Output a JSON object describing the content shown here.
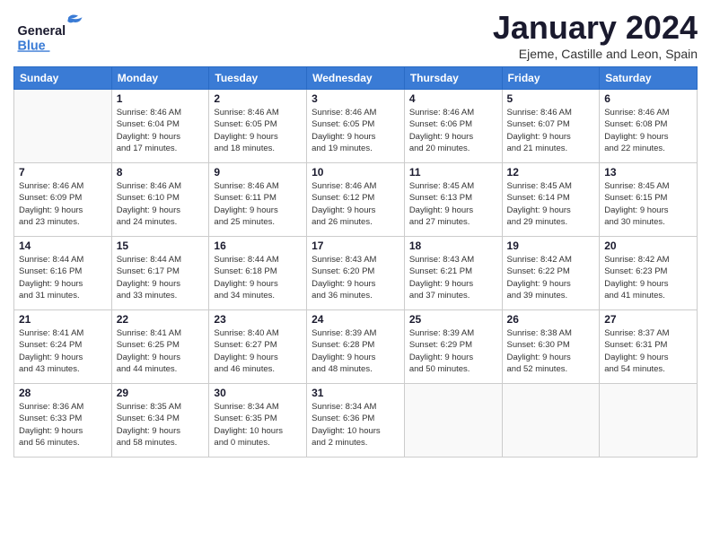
{
  "header": {
    "logo_general": "General",
    "logo_blue": "Blue",
    "month_title": "January 2024",
    "subtitle": "Ejeme, Castille and Leon, Spain"
  },
  "weekdays": [
    "Sunday",
    "Monday",
    "Tuesday",
    "Wednesday",
    "Thursday",
    "Friday",
    "Saturday"
  ],
  "weeks": [
    [
      {
        "day": "",
        "info": ""
      },
      {
        "day": "1",
        "info": "Sunrise: 8:46 AM\nSunset: 6:04 PM\nDaylight: 9 hours\nand 17 minutes."
      },
      {
        "day": "2",
        "info": "Sunrise: 8:46 AM\nSunset: 6:05 PM\nDaylight: 9 hours\nand 18 minutes."
      },
      {
        "day": "3",
        "info": "Sunrise: 8:46 AM\nSunset: 6:05 PM\nDaylight: 9 hours\nand 19 minutes."
      },
      {
        "day": "4",
        "info": "Sunrise: 8:46 AM\nSunset: 6:06 PM\nDaylight: 9 hours\nand 20 minutes."
      },
      {
        "day": "5",
        "info": "Sunrise: 8:46 AM\nSunset: 6:07 PM\nDaylight: 9 hours\nand 21 minutes."
      },
      {
        "day": "6",
        "info": "Sunrise: 8:46 AM\nSunset: 6:08 PM\nDaylight: 9 hours\nand 22 minutes."
      }
    ],
    [
      {
        "day": "7",
        "info": "Sunrise: 8:46 AM\nSunset: 6:09 PM\nDaylight: 9 hours\nand 23 minutes."
      },
      {
        "day": "8",
        "info": "Sunrise: 8:46 AM\nSunset: 6:10 PM\nDaylight: 9 hours\nand 24 minutes."
      },
      {
        "day": "9",
        "info": "Sunrise: 8:46 AM\nSunset: 6:11 PM\nDaylight: 9 hours\nand 25 minutes."
      },
      {
        "day": "10",
        "info": "Sunrise: 8:46 AM\nSunset: 6:12 PM\nDaylight: 9 hours\nand 26 minutes."
      },
      {
        "day": "11",
        "info": "Sunrise: 8:45 AM\nSunset: 6:13 PM\nDaylight: 9 hours\nand 27 minutes."
      },
      {
        "day": "12",
        "info": "Sunrise: 8:45 AM\nSunset: 6:14 PM\nDaylight: 9 hours\nand 29 minutes."
      },
      {
        "day": "13",
        "info": "Sunrise: 8:45 AM\nSunset: 6:15 PM\nDaylight: 9 hours\nand 30 minutes."
      }
    ],
    [
      {
        "day": "14",
        "info": "Sunrise: 8:44 AM\nSunset: 6:16 PM\nDaylight: 9 hours\nand 31 minutes."
      },
      {
        "day": "15",
        "info": "Sunrise: 8:44 AM\nSunset: 6:17 PM\nDaylight: 9 hours\nand 33 minutes."
      },
      {
        "day": "16",
        "info": "Sunrise: 8:44 AM\nSunset: 6:18 PM\nDaylight: 9 hours\nand 34 minutes."
      },
      {
        "day": "17",
        "info": "Sunrise: 8:43 AM\nSunset: 6:20 PM\nDaylight: 9 hours\nand 36 minutes."
      },
      {
        "day": "18",
        "info": "Sunrise: 8:43 AM\nSunset: 6:21 PM\nDaylight: 9 hours\nand 37 minutes."
      },
      {
        "day": "19",
        "info": "Sunrise: 8:42 AM\nSunset: 6:22 PM\nDaylight: 9 hours\nand 39 minutes."
      },
      {
        "day": "20",
        "info": "Sunrise: 8:42 AM\nSunset: 6:23 PM\nDaylight: 9 hours\nand 41 minutes."
      }
    ],
    [
      {
        "day": "21",
        "info": "Sunrise: 8:41 AM\nSunset: 6:24 PM\nDaylight: 9 hours\nand 43 minutes."
      },
      {
        "day": "22",
        "info": "Sunrise: 8:41 AM\nSunset: 6:25 PM\nDaylight: 9 hours\nand 44 minutes."
      },
      {
        "day": "23",
        "info": "Sunrise: 8:40 AM\nSunset: 6:27 PM\nDaylight: 9 hours\nand 46 minutes."
      },
      {
        "day": "24",
        "info": "Sunrise: 8:39 AM\nSunset: 6:28 PM\nDaylight: 9 hours\nand 48 minutes."
      },
      {
        "day": "25",
        "info": "Sunrise: 8:39 AM\nSunset: 6:29 PM\nDaylight: 9 hours\nand 50 minutes."
      },
      {
        "day": "26",
        "info": "Sunrise: 8:38 AM\nSunset: 6:30 PM\nDaylight: 9 hours\nand 52 minutes."
      },
      {
        "day": "27",
        "info": "Sunrise: 8:37 AM\nSunset: 6:31 PM\nDaylight: 9 hours\nand 54 minutes."
      }
    ],
    [
      {
        "day": "28",
        "info": "Sunrise: 8:36 AM\nSunset: 6:33 PM\nDaylight: 9 hours\nand 56 minutes."
      },
      {
        "day": "29",
        "info": "Sunrise: 8:35 AM\nSunset: 6:34 PM\nDaylight: 9 hours\nand 58 minutes."
      },
      {
        "day": "30",
        "info": "Sunrise: 8:34 AM\nSunset: 6:35 PM\nDaylight: 10 hours\nand 0 minutes."
      },
      {
        "day": "31",
        "info": "Sunrise: 8:34 AM\nSunset: 6:36 PM\nDaylight: 10 hours\nand 2 minutes."
      },
      {
        "day": "",
        "info": ""
      },
      {
        "day": "",
        "info": ""
      },
      {
        "day": "",
        "info": ""
      }
    ]
  ]
}
